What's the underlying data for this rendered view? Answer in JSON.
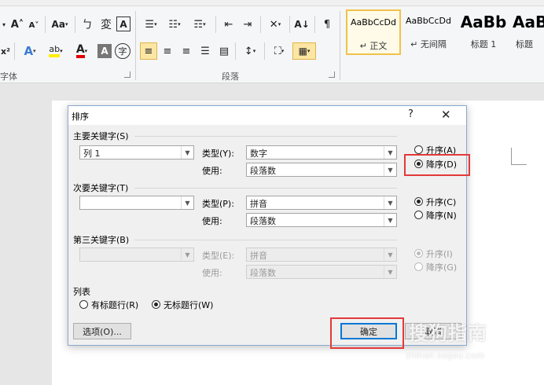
{
  "ribbon": {
    "font_group_label": "字体",
    "paragraph_group_label": "段落",
    "font_buttons": {
      "grow": "A˄",
      "shrink": "A˅",
      "change_case": "Aa",
      "phonetic": "ㄅ",
      "enclose": "変",
      "char_border": "A",
      "clear_format": "x²",
      "text_effect": "A",
      "highlight": "ab",
      "font_color": "A",
      "shading": "A",
      "enclose_circle": "字"
    },
    "styles": [
      {
        "sample": "AaBbCcDd",
        "name": "↵ 正文",
        "selected": true
      },
      {
        "sample": "AaBbCcDd",
        "name": "↵ 无间隔",
        "selected": false
      },
      {
        "sample": "AaBb",
        "name": "标题 1",
        "selected": false
      },
      {
        "sample": "AaB",
        "name": "标题",
        "selected": false
      }
    ]
  },
  "dialog": {
    "title": "排序",
    "help": "?",
    "close": "✕",
    "primary": {
      "section_label": "主要关键字(S)",
      "key_value": "列 1",
      "type_label": "类型(Y):",
      "type_value": "数字",
      "use_label": "使用:",
      "use_value": "段落数",
      "asc_label": "升序(A)",
      "desc_label": "降序(D)",
      "order": "desc"
    },
    "secondary": {
      "section_label": "次要关键字(T)",
      "key_value": "",
      "type_label": "类型(P):",
      "type_value": "拼音",
      "use_label": "使用:",
      "use_value": "段落数",
      "asc_label": "升序(C)",
      "desc_label": "降序(N)",
      "order": "asc"
    },
    "tertiary": {
      "section_label": "第三关键字(B)",
      "key_value": "",
      "type_label": "类型(E):",
      "type_value": "拼音",
      "use_label": "使用:",
      "use_value": "段落数",
      "asc_label": "升序(I)",
      "desc_label": "降序(G)",
      "order": "asc"
    },
    "list": {
      "section_label": "列表",
      "header_label": "有标题行(R)",
      "no_header_label": "无标题行(W)",
      "selected": "no_header"
    },
    "buttons": {
      "options": "选项(O)...",
      "ok": "确定",
      "cancel": "取消"
    }
  },
  "watermark": {
    "text": "搜狗指南",
    "url": "zhinan.sogou.com"
  },
  "colors": {
    "highlight_red": "#e23a3a",
    "default_button_blue": "#0078d7",
    "style_selected": "#f0c24b"
  }
}
